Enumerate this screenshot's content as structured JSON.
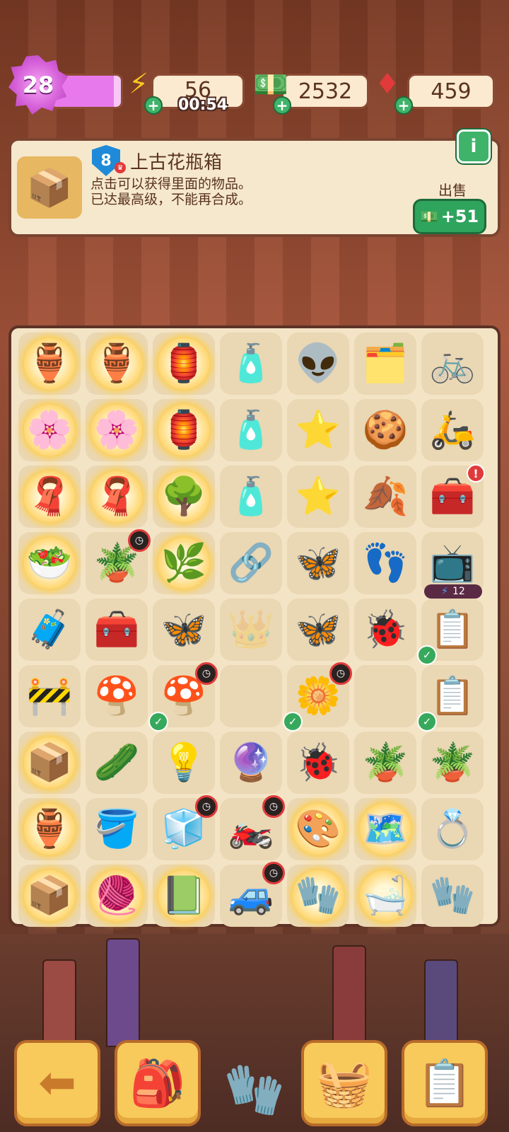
{
  "top_bar": {
    "level": "28",
    "xp_progress": 0.9,
    "energy": {
      "value": "56",
      "timer": "00:54",
      "icon": "lightning-icon"
    },
    "cash": {
      "value": "2532",
      "icon": "cash-stack-icon"
    },
    "gems": {
      "value": "459",
      "icon": "ruby-icon"
    },
    "plus_symbol": "+"
  },
  "info_panel": {
    "item_icon": "antique-vase-crate",
    "tier": "8",
    "title": "上古花瓶箱",
    "description_line1": "点击可以获得里面的物品。",
    "description_line2": "已达最高级，不能再合成。",
    "info_button": "i",
    "sell_label": "出售",
    "sell_value": "+51",
    "sell_icon": "cash-stack-icon"
  },
  "board": {
    "rows": [
      [
        {
          "item": "🏺",
          "name": "bubble-crate-item",
          "glow": true
        },
        {
          "item": "🏺",
          "name": "bubble-crate-item",
          "glow": true
        },
        {
          "item": "🏮",
          "name": "bubble-lantern-item",
          "glow": true
        },
        {
          "item": "🧴",
          "name": "lotion-bottle-item"
        },
        {
          "item": "👽",
          "name": "green-alien-item"
        },
        {
          "item": "🗂️",
          "name": "evidence-tray-item"
        },
        {
          "item": "🚲",
          "name": "folding-bike-item"
        }
      ],
      [
        {
          "item": "🌸",
          "name": "bubble-flower-item",
          "glow": true
        },
        {
          "item": "🌸",
          "name": "bubble-flower-item",
          "glow": true
        },
        {
          "item": "🏮",
          "name": "bubble-lantern-item",
          "glow": true
        },
        {
          "item": "🧴",
          "name": "lotion-bottle-item"
        },
        {
          "item": "⭐",
          "name": "purple-star-face-item"
        },
        {
          "item": "🍪",
          "name": "leaf-prints-item"
        },
        {
          "item": "🛵",
          "name": "purple-scooter-item"
        }
      ],
      [
        {
          "item": "🧣",
          "name": "bubble-scarf-item",
          "glow": true
        },
        {
          "item": "🧣",
          "name": "bubble-scarf-item",
          "glow": true
        },
        {
          "item": "🌳",
          "name": "bubble-tree-item",
          "glow": true
        },
        {
          "item": "🧴",
          "name": "lotion-bottle-item"
        },
        {
          "item": "⭐",
          "name": "purple-star-item"
        },
        {
          "item": "🍂",
          "name": "leaf-print-item"
        },
        {
          "item": "🧰",
          "name": "treasure-chest-item",
          "alert": "!"
        }
      ],
      [
        {
          "item": "🥗",
          "name": "bubble-bowl-item",
          "glow": true
        },
        {
          "item": "🪴",
          "name": "seedling-pot-item",
          "timer": true
        },
        {
          "item": "🌿",
          "name": "bubble-sapling-item",
          "glow": true
        },
        {
          "item": "🔗",
          "name": "ribbon-item"
        },
        {
          "item": "🦋",
          "name": "purple-moth-item"
        },
        {
          "item": "👣",
          "name": "footprint-bag-item"
        },
        {
          "item": "📺",
          "name": "tv-generator-item",
          "energy": "12"
        }
      ],
      [
        {
          "item": "🧳",
          "name": "red-case-item"
        },
        {
          "item": "🧰",
          "name": "red-toolbox-item"
        },
        {
          "item": "🦋",
          "name": "pale-moth-item"
        },
        {
          "item": "👑",
          "name": "crown-silhouette-item",
          "empty": true
        },
        {
          "item": "🦋",
          "name": "purple-moth-item"
        },
        {
          "item": "🐞",
          "name": "red-beetle-item"
        },
        {
          "item": "📋",
          "name": "clipboard-item",
          "check": true
        }
      ],
      [
        {
          "item": "🚧",
          "name": "barrier-item"
        },
        {
          "item": "🍄",
          "name": "glass-mushroom-item"
        },
        {
          "item": "🍄",
          "name": "glass-mushroom-item",
          "check": true,
          "timer": true
        },
        {
          "item": "",
          "name": "empty-cell",
          "empty": true
        },
        {
          "item": "🌼",
          "name": "flower-bush-item",
          "check": true,
          "timer": true
        },
        {
          "item": "",
          "name": "empty-cell",
          "empty": true
        },
        {
          "item": "📋",
          "name": "clipboard-item",
          "check": true
        }
      ],
      [
        {
          "item": "📦",
          "name": "bubble-box-item",
          "glow": true
        },
        {
          "item": "🥒",
          "name": "cucumber-item"
        },
        {
          "item": "💡",
          "name": "lightbulb-item"
        },
        {
          "item": "🔮",
          "name": "crystal-ball-box-item"
        },
        {
          "item": "🐞",
          "name": "ladybug-item"
        },
        {
          "item": "🪴",
          "name": "sprout-pot-item"
        },
        {
          "item": "🪴",
          "name": "leafy-pot-item"
        }
      ],
      [
        {
          "item": "🏺",
          "name": "bubble-vase-item",
          "glow": true
        },
        {
          "item": "🪣",
          "name": "yellow-bucket-item"
        },
        {
          "item": "🧊",
          "name": "cooler-box-item",
          "timer": true
        },
        {
          "item": "🏍️",
          "name": "purple-quad-item",
          "timer": true
        },
        {
          "item": "🎨",
          "name": "bubble-paint-item",
          "glow": true
        },
        {
          "item": "🗺️",
          "name": "bubble-map-item",
          "glow": true
        },
        {
          "item": "💍",
          "name": "gold-ring-item"
        }
      ],
      [
        {
          "item": "📦",
          "name": "bubble-crate-item",
          "glow": true
        },
        {
          "item": "🧶",
          "name": "bubble-yarn-item",
          "glow": true
        },
        {
          "item": "📗",
          "name": "bubble-book-item",
          "glow": true
        },
        {
          "item": "🚙",
          "name": "jeep-item",
          "timer": true
        },
        {
          "item": "🧤",
          "name": "bubble-glove-item",
          "glow": true
        },
        {
          "item": "🛁",
          "name": "bubble-tub-item",
          "glow": true
        },
        {
          "item": "🧤",
          "name": "red-glove-item"
        }
      ]
    ],
    "check_symbol": "✓",
    "timer_symbol": "◷",
    "energy_bolt": "⚡"
  },
  "bottom_nav": {
    "back_icon": "arrow-left-icon",
    "backpack_icon": "backpack-icon",
    "glove_icon": "glove-icon",
    "basket_icon": "basket-icon",
    "tasks_icon": "clipboard-star-icon"
  },
  "colors": {
    "accent_green": "#3fb36a",
    "panel": "#f6e8cd",
    "board": "#f4e4c6",
    "nav": "#f8c95b"
  }
}
